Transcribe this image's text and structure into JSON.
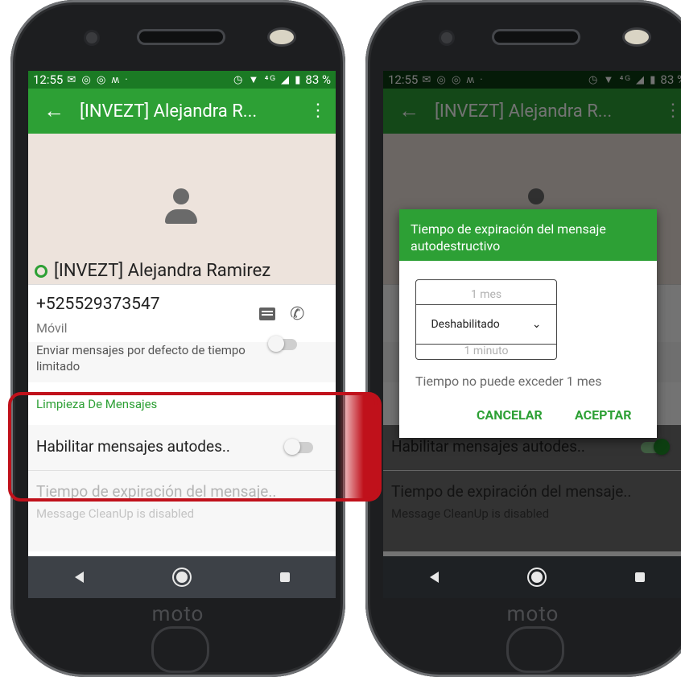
{
  "status_bar": {
    "time": "12:55",
    "notif_icons": "✉ ◎ ◎ ʍ ·",
    "sys_icons": "◷ ▼ ⁴ᴳ ◢ ▮",
    "battery": "83 %"
  },
  "app_bar": {
    "back_icon": "←",
    "title": "[INVEZT] Alejandra R...",
    "menu_icon": "⋮"
  },
  "contact": {
    "name": "[INVEZT] Alejandra Ramirez",
    "phone": "+525529373547",
    "phone_type": "Móvil"
  },
  "settings": {
    "limited_default": "Enviar mensajes por defecto de tiempo limitado",
    "section_title": "Limpieza De Mensajes",
    "enable_self_destruct": "Habilitar mensajes autodes..",
    "expiration_time": "Tiempo de expiración del mensaje..",
    "cleanup_status": "Message CleanUp is disabled"
  },
  "dialog": {
    "title": "Tiempo de expiración del mensaje autodestructivo",
    "picker_prev": "1 mes",
    "picker_selected": "Deshabilitado",
    "picker_next": "1 minuto",
    "hint": "Tiempo no puede exceder 1 mes",
    "cancel": "CANCELAR",
    "accept": "ACEPTAR"
  },
  "brand": "moto",
  "toggles": {
    "left_enable_self_destruct": false,
    "right_enable_self_destruct": true
  },
  "colors": {
    "status_bar": "#1b7a24",
    "app_bar": "#2da035",
    "accent": "#2da035",
    "highlight": "#c0111b"
  }
}
